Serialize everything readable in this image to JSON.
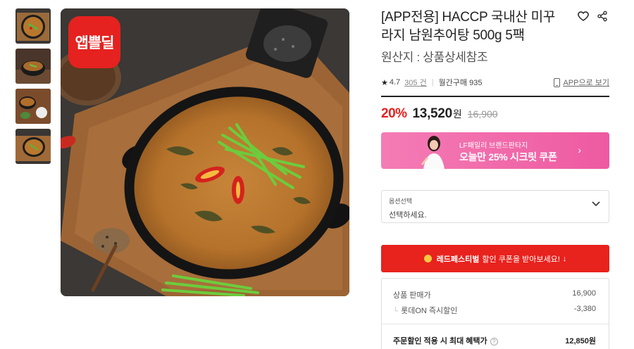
{
  "product": {
    "title": "[APP전용] HACCP 국내산 미꾸라지 남원추어탕 500g 5팩",
    "origin": "원산지 : 상품상세참조",
    "badge_text": "앱쁠딜",
    "thumbnail_count": 4
  },
  "meta": {
    "rating": "4.7",
    "reviews": "305 건",
    "monthly_purchase": "월간구매 935",
    "app_view": "APP으로 보기"
  },
  "price": {
    "discount_rate": "20%",
    "sale_price": "13,520",
    "currency": "원",
    "original_price": "16,900"
  },
  "coupon_banner": {
    "subtitle": "LF패밀리 브랜드판타지",
    "headline": "오늘만 25% 시크릿 쿠폰",
    "arrow": "›"
  },
  "option": {
    "label": "옵션선택",
    "value": "선택하세요."
  },
  "red_festival": {
    "bold": "레드페스티벌",
    "text": "할인 쿠폰을 받아보세요!",
    "arrow": "↓"
  },
  "breakdown": {
    "list_price_label": "상품 판매가",
    "list_price": "16,900",
    "instant_label": "롯데ON 즉시할인",
    "instant_value": "-3,380",
    "max_label": "주문할인 적용 시 최대 혜택가",
    "help": "?",
    "max_value": "12,850원"
  },
  "colors": {
    "accent_red": "#e5221f",
    "coupon_pink": "#ee5aa1",
    "festival_red": "#e8221d"
  }
}
